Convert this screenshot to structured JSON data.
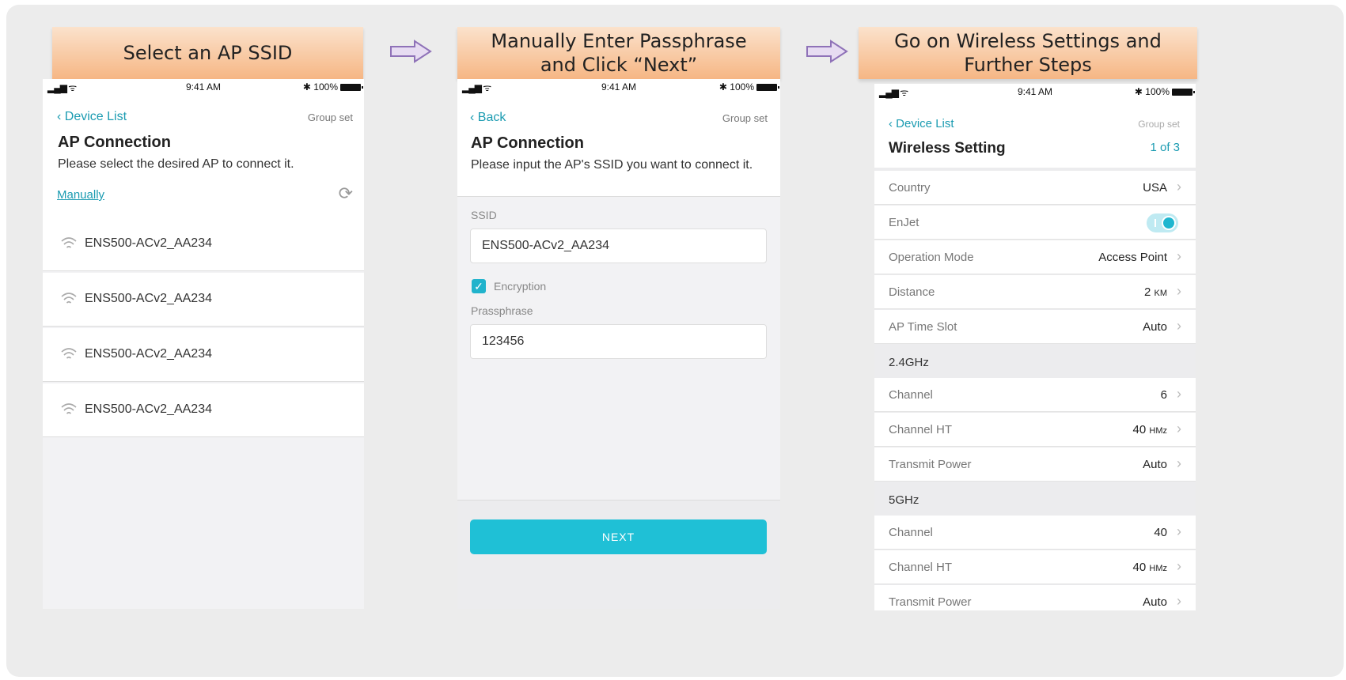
{
  "banners": {
    "step1": "Select an AP SSID",
    "step2_line1": "Manually Enter Passphrase",
    "step2_line2": "and Click “Next”",
    "step3_line1": "Go on Wireless Settings and",
    "step3_line2": "Further Steps"
  },
  "status_bar": {
    "time": "9:41 AM",
    "battery": "100%"
  },
  "screen1": {
    "back": "Device List",
    "group_set": "Group set",
    "title": "AP Connection",
    "subtitle": "Please select the desired AP to connect it.",
    "manually": "Manually",
    "ap_list": [
      "ENS500-ACv2_AA234",
      "ENS500-ACv2_AA234",
      "ENS500-ACv2_AA234",
      "ENS500-ACv2_AA234"
    ]
  },
  "screen2": {
    "back": "Back",
    "group_set": "Group set",
    "title": "AP Connection",
    "subtitle": "Please input the AP's SSID you want to connect it.",
    "ssid_label": "SSID",
    "ssid_value": "ENS500-ACv2_AA234",
    "encryption_label": "Encryption",
    "passphrase_label": "Prassphrase",
    "passphrase_value": "123456",
    "next": "NEXT"
  },
  "screen3": {
    "back": "Device List",
    "group_set": "Group set",
    "title": "Wireless Setting",
    "pager": "1 of 3",
    "rows_general": [
      {
        "label": "Country",
        "value": "USA"
      },
      {
        "label": "EnJet",
        "value": ""
      },
      {
        "label": "Operation Mode",
        "value": "Access Point"
      },
      {
        "label": "Distance",
        "value": "2",
        "unit": "KM"
      },
      {
        "label": "AP Time Slot",
        "value": "Auto"
      }
    ],
    "section_24": "2.4GHz",
    "rows_24": [
      {
        "label": "Channel",
        "value": "6"
      },
      {
        "label": "Channel HT",
        "value": "40",
        "unit": "HMz"
      },
      {
        "label": "Transmit Power",
        "value": "Auto"
      }
    ],
    "section_5": "5GHz",
    "rows_5": [
      {
        "label": "Channel",
        "value": "40"
      },
      {
        "label": "Channel HT",
        "value": "40",
        "unit": "HMz"
      },
      {
        "label": "Transmit Power",
        "value": "Auto"
      }
    ]
  },
  "colors": {
    "accent": "#1a9bb1",
    "button": "#1fc0d6",
    "banner": "#f6b684"
  }
}
